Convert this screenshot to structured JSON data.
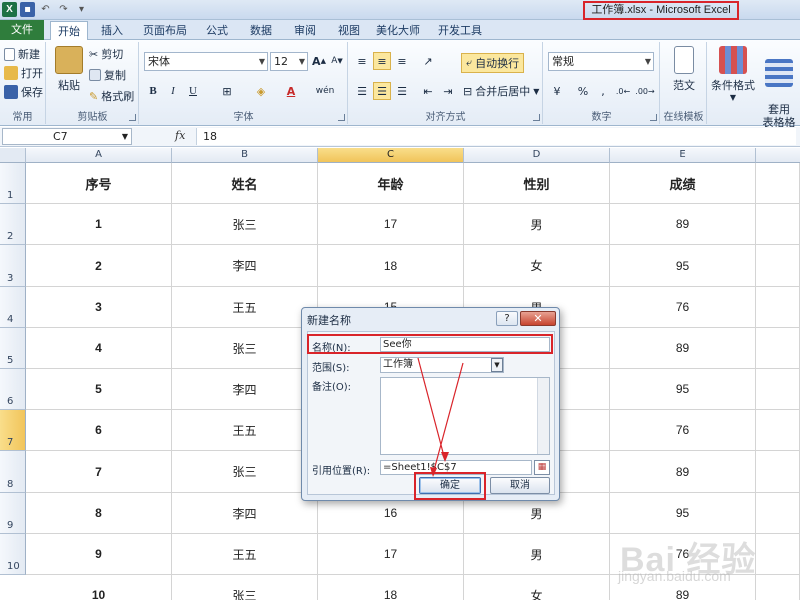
{
  "window": {
    "title": "工作簿.xlsx - Microsoft Excel"
  },
  "tabs": [
    "文件",
    "开始",
    "插入",
    "页面布局",
    "公式",
    "数据",
    "审阅",
    "视图",
    "美化大师",
    "开发工具"
  ],
  "ribbon": {
    "clipboard": {
      "label": "常用",
      "new": "新建",
      "open": "打开",
      "save": "保存"
    },
    "paste": {
      "label": "剪贴板",
      "paste": "粘贴",
      "cut": "剪切",
      "copy": "复制",
      "format_painter": "格式刷"
    },
    "font": {
      "label": "字体",
      "font_name": "宋体",
      "font_size": "12"
    },
    "alignment": {
      "label": "对齐方式",
      "wrap": "自动换行",
      "merge": "合并后居中"
    },
    "number": {
      "label": "数字",
      "format": "常规"
    },
    "online": {
      "label": "在线模板",
      "template": "范文"
    },
    "styles": {
      "conditional": "条件格式",
      "table_style": "套用\n表格格式"
    }
  },
  "formula_bar": {
    "name_box": "C7",
    "fx": "fx",
    "content": "18"
  },
  "columns": [
    "A",
    "B",
    "C",
    "D",
    "E"
  ],
  "rows": [
    "1",
    "2",
    "3",
    "4",
    "5",
    "6",
    "7",
    "8",
    "9",
    "10"
  ],
  "table": {
    "headers": [
      "序号",
      "姓名",
      "年龄",
      "性别",
      "成绩"
    ],
    "rows": [
      [
        "1",
        "张三",
        "17",
        "男",
        "89"
      ],
      [
        "2",
        "李四",
        "18",
        "女",
        "95"
      ],
      [
        "3",
        "王五",
        "15",
        "男",
        "76"
      ],
      [
        "4",
        "张三",
        "",
        "",
        "89"
      ],
      [
        "5",
        "李四",
        "",
        "",
        "95"
      ],
      [
        "6",
        "王五",
        "",
        "",
        "76"
      ],
      [
        "7",
        "张三",
        "",
        "",
        "89"
      ],
      [
        "8",
        "李四",
        "16",
        "男",
        "95"
      ],
      [
        "9",
        "王五",
        "17",
        "男",
        "76"
      ],
      [
        "10",
        "张三",
        "18",
        "女",
        "89"
      ]
    ]
  },
  "dialog": {
    "title": "新建名称",
    "help": "?",
    "close": "✕",
    "name_label": "名称(N):",
    "name_value": "See你",
    "scope_label": "范围(S):",
    "scope_value": "工作簿",
    "comment_label": "备注(O):",
    "ref_label": "引用位置(R):",
    "ref_value": "=Sheet1!$C$7",
    "ok": "确定",
    "cancel": "取消"
  },
  "watermark": {
    "brand": "Bai 经验",
    "url": "jingyan.baidu.com"
  },
  "colors": {
    "highlight": "#d9242a",
    "file_tab": "#2f7d3c",
    "selected_header": "#f1c45a"
  }
}
